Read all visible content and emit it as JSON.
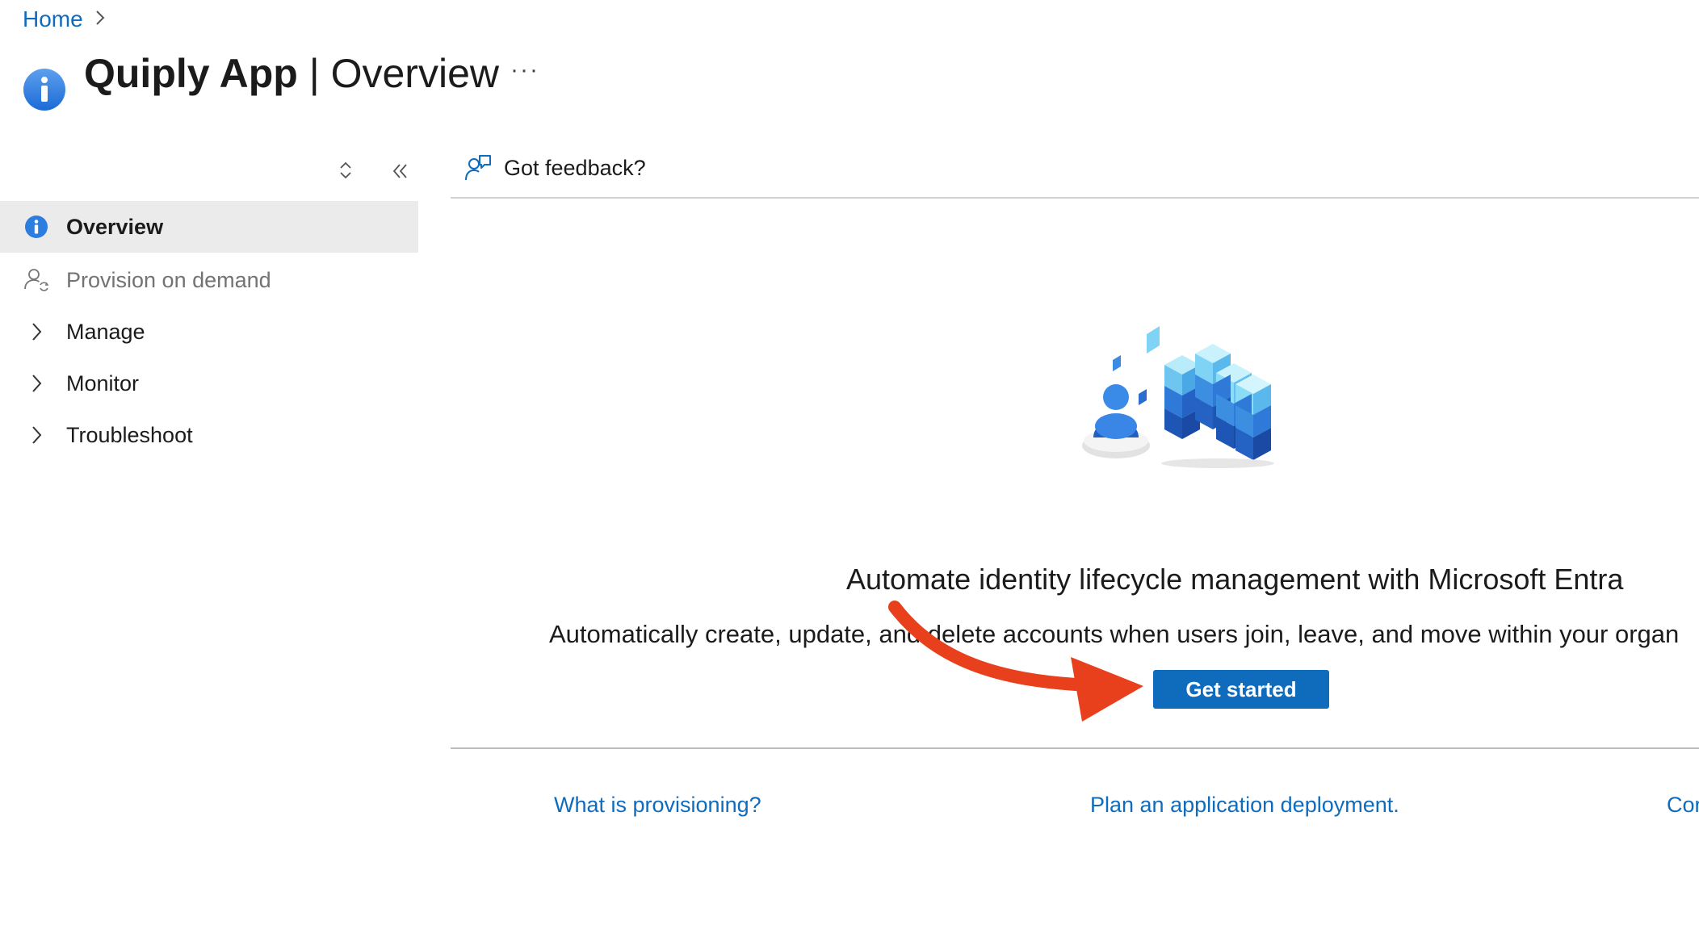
{
  "breadcrumb": {
    "home": "Home"
  },
  "header": {
    "app_name": "Quiply App",
    "separator": "|",
    "section": "Overview",
    "more": "···"
  },
  "sidebar": {
    "items": [
      {
        "label": "Overview",
        "icon": "info-icon",
        "selected": true
      },
      {
        "label": "Provision on demand",
        "icon": "user-sync-icon",
        "disabled": true
      },
      {
        "label": "Manage",
        "icon": "chevron-right-icon"
      },
      {
        "label": "Monitor",
        "icon": "chevron-right-icon"
      },
      {
        "label": "Troubleshoot",
        "icon": "chevron-right-icon"
      }
    ]
  },
  "command_bar": {
    "feedback_label": "Got feedback?"
  },
  "main": {
    "headline": "Automate identity lifecycle management with Microsoft Entra",
    "subtext": "Automatically create, update, and delete accounts when users join, leave, and move within your organ",
    "cta": "Get started",
    "links": [
      "What is provisioning?",
      "Plan an application deployment.",
      "Cor"
    ]
  },
  "colors": {
    "accent": "#0f6cbd",
    "annotation_arrow": "#e8401c",
    "selected_bg": "#ebebeb"
  }
}
